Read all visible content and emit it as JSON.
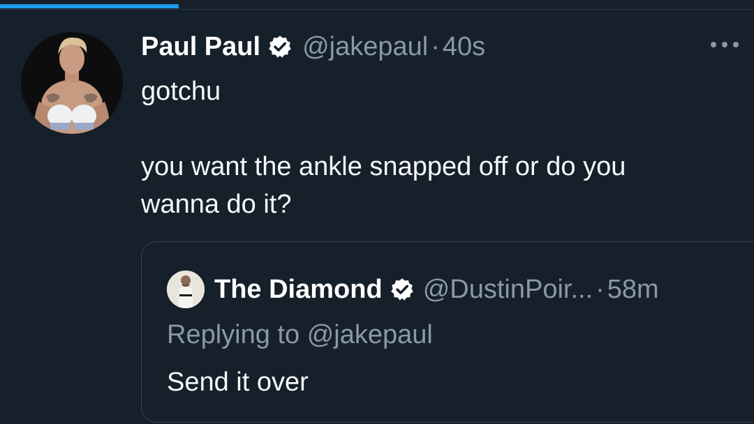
{
  "progress": {
    "fraction": 0.237,
    "color": "#1d9bf0"
  },
  "tweet": {
    "display_name": "Paul Paul",
    "verified_icon": "verified-badge-icon",
    "handle": "@jakepaul",
    "separator": "·",
    "time": "40s",
    "text_line1": "gotchu",
    "text_line2": "you want the ankle snapped off or do you",
    "text_line3": "wanna do it?",
    "avatar_icon": "boxer-avatar"
  },
  "more_icon": "more-options-icon",
  "quote": {
    "display_name": "The Diamond",
    "verified_icon": "verified-badge-icon",
    "handle": "@DustinPoir...",
    "separator": "·",
    "time": "58m",
    "replying_label": "Replying to",
    "replying_handle": "@jakepaul",
    "text": "Send it over",
    "avatar_icon": "fighter-avatar"
  },
  "colors": {
    "background": "#15202b",
    "secondary_text": "#8b98a5",
    "accent": "#1d9bf0",
    "border": "#38444d"
  }
}
